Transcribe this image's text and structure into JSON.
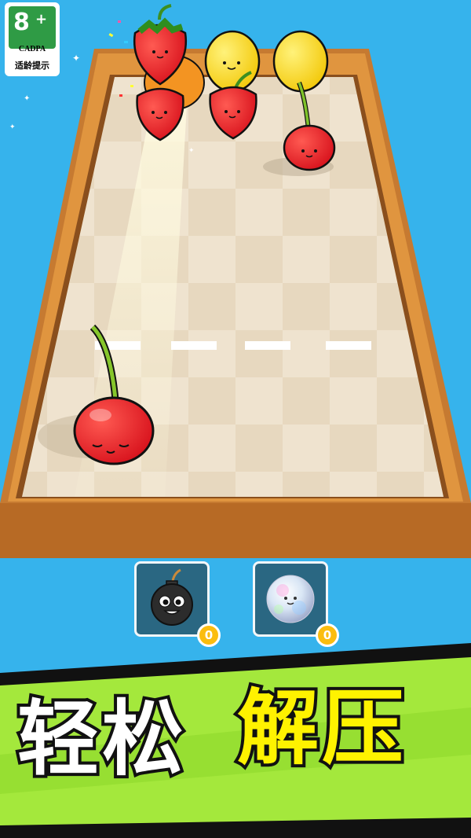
{
  "age_rating": {
    "number": "8",
    "plus": "+",
    "org": "CADPA",
    "text": "适龄提示"
  },
  "board": {
    "lane_markers": 4
  },
  "fruits": [
    {
      "kind": "strawberry",
      "name": "fruit-strawberry-top"
    },
    {
      "kind": "orange",
      "name": "fruit-orange"
    },
    {
      "kind": "lemon",
      "name": "fruit-lemon-1"
    },
    {
      "kind": "lemon",
      "name": "fruit-lemon-2"
    },
    {
      "kind": "strawberry",
      "name": "fruit-strawberry-1"
    },
    {
      "kind": "strawberry",
      "name": "fruit-strawberry-2"
    },
    {
      "kind": "cherry",
      "name": "fruit-cherry-far"
    },
    {
      "kind": "cherry",
      "name": "fruit-cherry-launcher"
    }
  ],
  "powerups": [
    {
      "name": "bomb",
      "icon": "bomb-icon",
      "count": "0"
    },
    {
      "name": "crystal-ball",
      "icon": "crystal-ball-icon",
      "count": "0"
    }
  ],
  "slogan": {
    "white": "轻松",
    "yellow": "解压"
  },
  "colors": {
    "sky": "#36b3ec",
    "wood": "#c9782d",
    "banner_green": "#a4e83c",
    "banner_dark": "#111111",
    "yellow_text": "#fff200"
  }
}
